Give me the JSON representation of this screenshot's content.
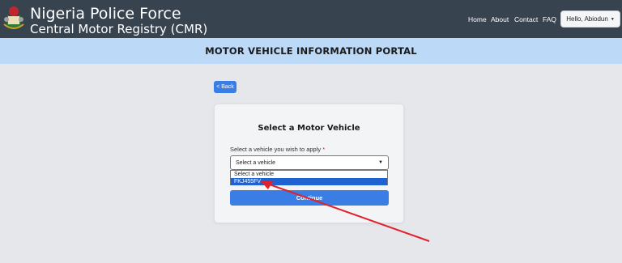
{
  "header": {
    "title": "Nigeria Police Force",
    "subtitle": "Central Motor Registry (CMR)",
    "nav": [
      "Home",
      "About",
      "Contact",
      "FAQ"
    ],
    "user_menu_label": "Hello, Abiodun"
  },
  "banner": {
    "title": "MOTOR VEHICLE INFORMATION PORTAL"
  },
  "back_button": "< Back",
  "card": {
    "title": "Select a Motor Vehicle",
    "field_label": "Select a vehicle you wish to apply",
    "required_mark": "*",
    "select_value": "Select a vehicle",
    "options": [
      "Select a vehicle",
      "FKJ455FV"
    ],
    "highlighted_option": "FKJ455FV",
    "continue_label": "Continue"
  },
  "colors": {
    "navbar": "#384350",
    "banner": "#bcd9f7",
    "primary": "#3a7de5",
    "annotation_arrow": "#e0212b"
  }
}
